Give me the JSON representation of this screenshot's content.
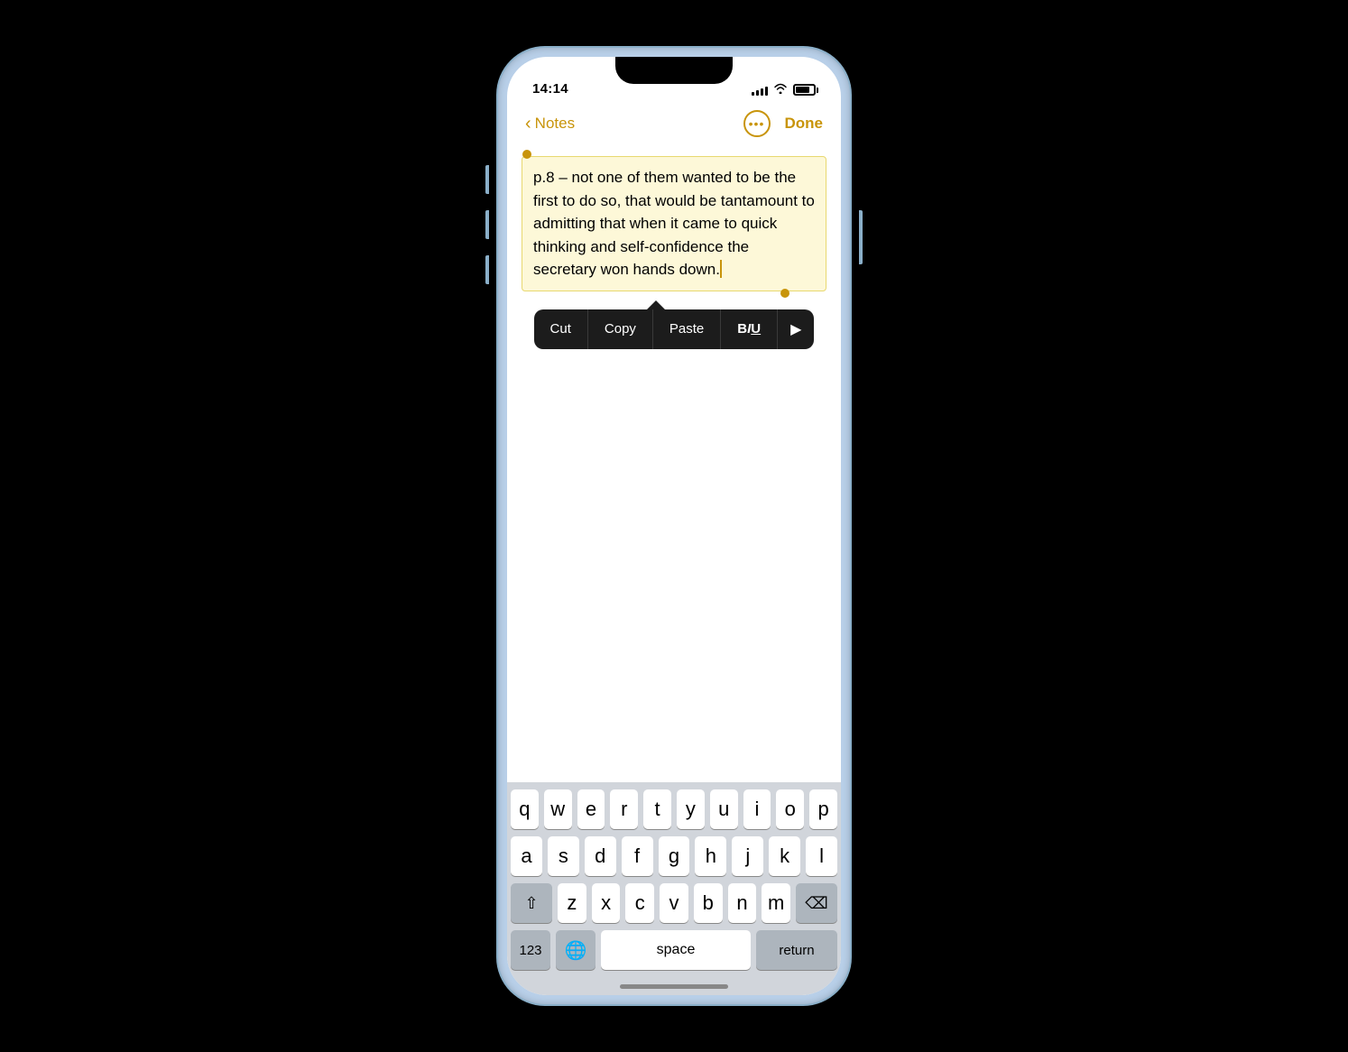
{
  "phone": {
    "status_bar": {
      "time": "14:14",
      "signal": [
        3,
        5,
        7,
        9,
        11
      ],
      "battery_label": "battery"
    },
    "nav": {
      "back_label": "Notes",
      "more_label": "...",
      "done_label": "Done"
    },
    "note": {
      "text": "p.8 – not one of them wanted to be the first to do so, that would be tantamount to admitting that when it came to quick thinking and self-confidence the secretary won hands down."
    },
    "context_menu": {
      "cut_label": "Cut",
      "copy_label": "Copy",
      "paste_label": "Paste",
      "biu_label": "BIU",
      "arrow_label": "▶"
    },
    "keyboard": {
      "row1": [
        "q",
        "w",
        "e",
        "r",
        "t",
        "y",
        "u",
        "i",
        "o",
        "p"
      ],
      "row2": [
        "a",
        "s",
        "d",
        "f",
        "g",
        "h",
        "j",
        "k",
        "l"
      ],
      "row3": [
        "z",
        "x",
        "c",
        "v",
        "b",
        "n",
        "m"
      ],
      "space_label": "space",
      "return_label": "return",
      "num_label": "123",
      "shift_label": "⇧",
      "delete_label": "⌫"
    }
  }
}
